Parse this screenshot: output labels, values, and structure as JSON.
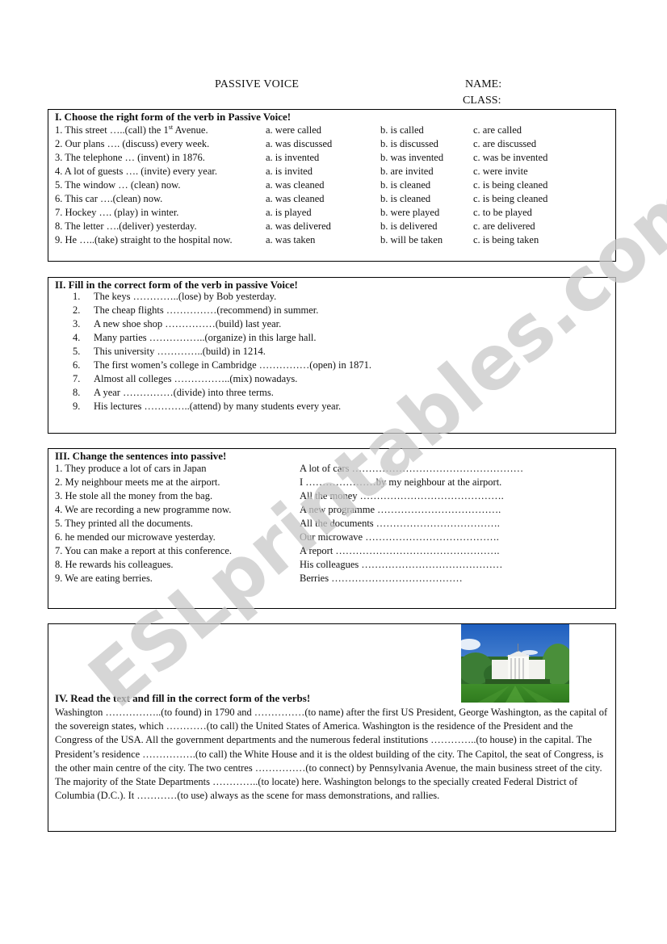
{
  "header": {
    "title": "PASSIVE VOICE",
    "name_label": "NAME:",
    "class_label": "CLASS:"
  },
  "section1": {
    "title": "I. Choose the right form of the verb in Passive Voice!",
    "items": [
      {
        "q_pre": "1. This street …..(call) the 1",
        "q_sup": "st",
        "q_post": " Avenue.",
        "a": "a. were called",
        "b": "b. is called",
        "c": "c. are called"
      },
      {
        "q_pre": "2. Our plans …. (discuss) every week.",
        "q_sup": "",
        "q_post": "",
        "a": "a.  was discussed",
        "b": "b. is discussed",
        "c": "c. are discussed"
      },
      {
        "q_pre": "3. The telephone … (invent) in 1876.",
        "q_sup": "",
        "q_post": "",
        "a": "a. is invented",
        "b": "b. was invented",
        "c": "c. was be invented"
      },
      {
        "q_pre": "4. A lot of guests …. (invite) every year.",
        "q_sup": "",
        "q_post": "",
        "a": "a. is invited",
        "b": "b. are invited",
        "c": "c. were invite"
      },
      {
        "q_pre": "5. The window … (clean) now.",
        "q_sup": "",
        "q_post": "",
        "a": "a. was cleaned",
        "b": "b. is cleaned",
        "c": "c. is being cleaned"
      },
      {
        "q_pre": "6. This car ….(clean) now.",
        "q_sup": "",
        "q_post": "",
        "a": "a. was cleaned",
        "b": "b. is cleaned",
        "c": "c. is being cleaned"
      },
      {
        "q_pre": "7. Hockey …. (play) in winter.",
        "q_sup": "",
        "q_post": "",
        "a": "a. is played",
        "b": "b. were played",
        "c": "c. to be played"
      },
      {
        "q_pre": "8. The letter ….(deliver) yesterday.",
        "q_sup": "",
        "q_post": "",
        "a": "a. was delivered",
        "b": "b. is delivered",
        "c": "c. are delivered"
      },
      {
        "q_pre": "9. He …..(take) straight to the hospital now.",
        "q_sup": "",
        "q_post": "",
        "a": "a. was taken",
        "b": "b. will be taken",
        "c": "c. is being taken"
      }
    ]
  },
  "section2": {
    "title": "II. Fill in the correct form of the verb in passive Voice!",
    "items": [
      {
        "num": "1.",
        "text": "The keys …………..(lose) by Bob yesterday."
      },
      {
        "num": "2.",
        "text": "The cheap flights ……………(recommend) in summer."
      },
      {
        "num": "3.",
        "text": "A new shoe shop ……………(build) last year."
      },
      {
        "num": "4.",
        "text": "Many parties ……………..(organize) in this large hall."
      },
      {
        "num": "5.",
        "text": "This university …………..(build) in 1214."
      },
      {
        "num": "6.",
        "text": "The first women’s college in Cambridge ……………(open) in 1871."
      },
      {
        "num": "7.",
        "text": "Almost all colleges ……………..(mix) nowadays."
      },
      {
        "num": "8.",
        "text": "A year ……………(divide) into three terms."
      },
      {
        "num": "9.",
        "text": "His lectures …………..(attend) by many students every year."
      }
    ]
  },
  "section3": {
    "title": "III. Change the sentences into passive!",
    "items": [
      {
        "active": "1. They produce a  lot of cars in Japan",
        "passive": "A lot of cars ……………………………………………"
      },
      {
        "active": "2. My neighbour meets me at the airport.",
        "passive": " I …………………by my neighbour at the airport."
      },
      {
        "active": "3. He stole all the money from the bag.",
        "passive": "All the money ……………………………………."
      },
      {
        "active": "4. We are recording a new programme now.",
        "passive": "A new programme ………………………………."
      },
      {
        "active": "5. They printed all the documents.",
        "passive": "All the documents ………………………………."
      },
      {
        "active": "6. he mended our microwave yesterday.",
        "passive": "Our microwave …………………………………."
      },
      {
        "active": "7. You can make a report at this conference.",
        "passive": "A report …………………………………………."
      },
      {
        "active": "8. He rewards his colleagues.",
        "passive": "His colleagues ……………………………………"
      },
      {
        "active": "9. We are eating berries.",
        "passive": "Berries …………………………………"
      }
    ]
  },
  "section4": {
    "title": "IV. Read the text and fill in the correct form of the verbs!",
    "paragraph": "Washington ……………..(to found) in 1790 and ……………(to name) after the first US President, George Washington, as the capital of the sovereign states, which  …………(to call) the United States of America. Washington is the residence of the President and the Congress of the USA. All the government departments  and the numerous federal institutions …………..(to house) in the capital. The President’s residence …………….(to call) the White House and it is the oldest building of the city. The Capitol, the seat of Congress, is the other main centre of the city. The two centres ……………(to connect) by Pennsylvania Avenue, the main business street of the city. The majority of the State Departments …………..(to locate) here. Washington belongs to the specially created Federal District of Columbia (D.C.). It …………(to use) always as the scene for mass demonstrations, and rallies.",
    "image": "white-house-photo"
  },
  "watermark": {
    "text": "ESLprintables.com",
    "color": "#c8c8c8"
  }
}
